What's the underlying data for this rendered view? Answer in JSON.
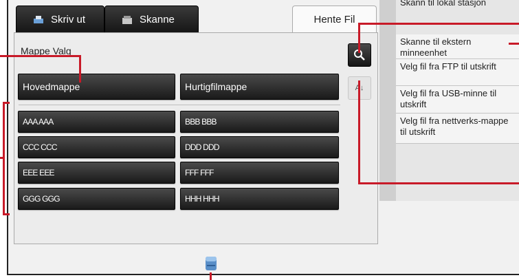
{
  "tabs": {
    "print": "Skriv ut",
    "scan": "Skanne",
    "retrieve": "Hente Fil"
  },
  "panel": {
    "title": "Mappe Valg"
  },
  "buttons": {
    "main_folder": "Hovedmappe",
    "quick_folder": "Hurtigfilmappe"
  },
  "folders": [
    "AAA AAA",
    "BBB BBB",
    "CCC CCC",
    "DDD DDD",
    "EEE EEE",
    "FFF FFF",
    "GGG GGG",
    "HHH HHH"
  ],
  "sort_label": "A↓",
  "menu": {
    "top_partial": "Skann til lokal stasjon",
    "items": [
      "Skanne til ekstern minneenhet",
      "Velg fil fra FTP til utskrift",
      "Velg fil fra USB-minne til utskrift",
      "Velg fil fra nettverks-mappe til utskrift"
    ]
  },
  "colors": {
    "callout": "#c81a28",
    "button_dark": "#1a1a1a",
    "panel_bg": "#ececec"
  }
}
